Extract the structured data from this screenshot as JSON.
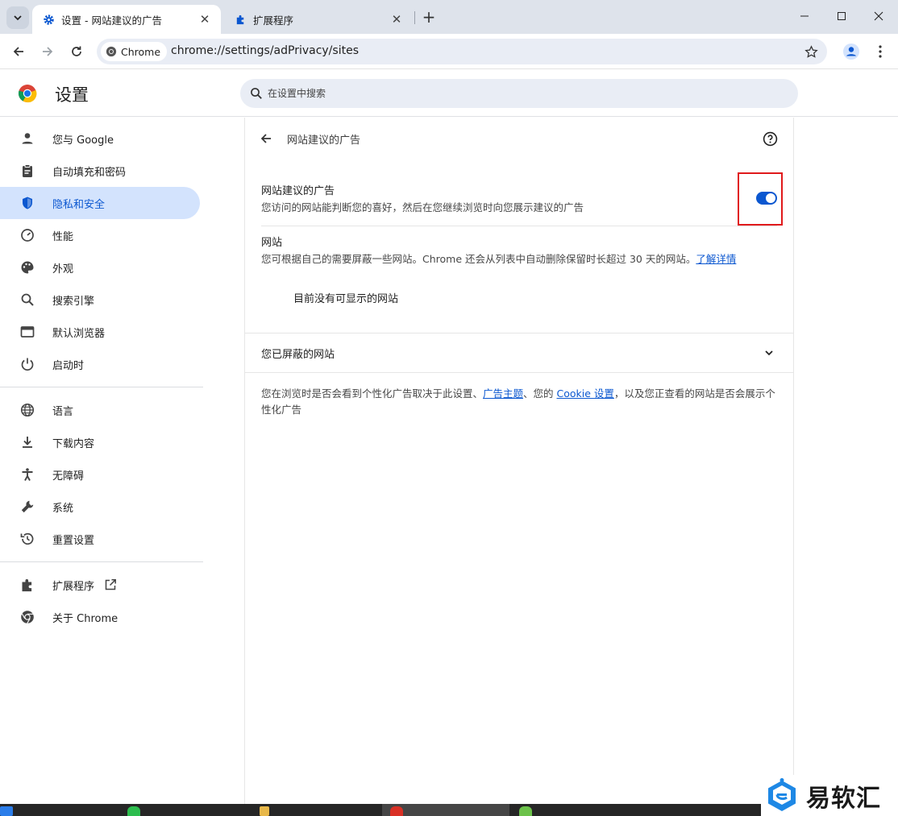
{
  "browser": {
    "tabs": [
      {
        "title": "设置 - 网站建议的广告",
        "active": true
      },
      {
        "title": "扩展程序",
        "active": false
      }
    ],
    "new_tab_symbol": "+",
    "close_symbol": "✕",
    "chip_label": "Chrome",
    "url": "chrome://settings/adPrivacy/sites"
  },
  "settings": {
    "title": "设置",
    "search_placeholder": "在设置中搜索",
    "nav": [
      {
        "label": "您与 Google",
        "icon": "person-icon",
        "active": false
      },
      {
        "label": "自动填充和密码",
        "icon": "clipboard-icon",
        "active": false
      },
      {
        "label": "隐私和安全",
        "icon": "shield-icon",
        "active": true
      },
      {
        "label": "性能",
        "icon": "speedometer-icon",
        "active": false
      },
      {
        "label": "外观",
        "icon": "palette-icon",
        "active": false
      },
      {
        "label": "搜索引擎",
        "icon": "search-icon",
        "active": false
      },
      {
        "label": "默认浏览器",
        "icon": "browser-window-icon",
        "active": false
      },
      {
        "label": "启动时",
        "icon": "power-icon",
        "active": false
      },
      {
        "label": "语言",
        "icon": "globe-icon",
        "active": false
      },
      {
        "label": "下载内容",
        "icon": "download-icon",
        "active": false
      },
      {
        "label": "无障碍",
        "icon": "accessibility-icon",
        "active": false
      },
      {
        "label": "系统",
        "icon": "wrench-icon",
        "active": false
      },
      {
        "label": "重置设置",
        "icon": "reset-history-icon",
        "active": false
      },
      {
        "label": "扩展程序",
        "icon": "puzzle-icon",
        "active": false
      },
      {
        "label": "关于 Chrome",
        "icon": "chrome-icon",
        "active": false
      }
    ]
  },
  "page": {
    "title": "网站建议的广告",
    "toggle_row": {
      "title": "网站建议的广告",
      "subtitle": "您访问的网站能判断您的喜好，然后在您继续浏览时向您展示建议的广告",
      "enabled": true
    },
    "sites_row": {
      "title": "网站",
      "subtitle_prefix": "您可根据自己的需要屏蔽一些网站。Chrome 还会从列表中自动删除保留时长超过 30 天的网站。",
      "link": "了解详情"
    },
    "empty_text": "目前没有可显示的网站",
    "blocked_title": "您已屏蔽的网站",
    "footnote": {
      "part1": "您在浏览时是否会看到个性化广告取决于此设置、",
      "link1": "广告主题",
      "part2": "、您的 ",
      "link2": "Cookie 设置",
      "part3": "，以及您正查看的网站是否会展示个性化广告"
    }
  },
  "watermark": {
    "text": "易软汇"
  },
  "colors": {
    "accent": "#0b57d0",
    "active_nav_bg": "#d3e3fd",
    "highlight_box": "#e0191b",
    "tabstrip_bg": "#dee3eb"
  }
}
